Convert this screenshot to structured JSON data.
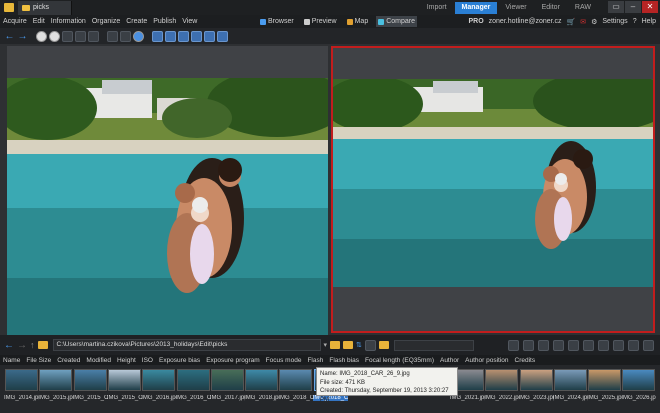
{
  "tab_title": "picks",
  "modes": [
    "Import",
    "Manager",
    "Viewer",
    "Editor",
    "RAW"
  ],
  "active_mode": "Manager",
  "menu": [
    "Acquire",
    "Edit",
    "Information",
    "Organize",
    "Create",
    "Publish",
    "View"
  ],
  "views": [
    {
      "label": "Browser",
      "icon": "browser-icon",
      "color": "#4a9cf0"
    },
    {
      "label": "Preview",
      "icon": "preview-icon",
      "color": "#cccccc"
    },
    {
      "label": "Map",
      "icon": "map-icon",
      "color": "#e0a030"
    },
    {
      "label": "Compare",
      "icon": "compare-icon",
      "color": "#4ac0e0"
    }
  ],
  "account": {
    "tier": "PRO",
    "email": "zoner.hotline@zoner.cz",
    "settings": "Settings",
    "help": "Help"
  },
  "path": "C:\\Users\\martina.czikova\\Pictures\\2013_holidays\\Edit\\picks",
  "columns": [
    "Name",
    "File Size",
    "Created",
    "Modified",
    "Height",
    "ISO",
    "Exposure bias",
    "Exposure program",
    "Focus mode",
    "Flash",
    "Flash bias",
    "Focal length (EQ35mm)",
    "Author",
    "Author position",
    "Credits"
  ],
  "thumbs": [
    {
      "label": "IMG_2014.jpg",
      "sel": false
    },
    {
      "label": "IMG_2015.jpg",
      "sel": false
    },
    {
      "label": "IMG_2015_C...",
      "sel": false
    },
    {
      "label": "IMG_2015_C...",
      "sel": false
    },
    {
      "label": "IMG_2016.jpg",
      "sel": false
    },
    {
      "label": "IMG_2016_C...",
      "sel": false
    },
    {
      "label": "IMG_2017.jpg",
      "sel": false
    },
    {
      "label": "IMG_2018.jpg",
      "sel": false
    },
    {
      "label": "IMG_2018_C...",
      "sel": false
    },
    {
      "label": "IMG_2018_C...",
      "sel": true
    },
    {
      "label": "",
      "sel": false
    },
    {
      "label": "",
      "sel": false
    },
    {
      "label": "",
      "sel": false
    },
    {
      "label": "IMG_2021.jpg",
      "sel": false
    },
    {
      "label": "IMG_2022.jpg",
      "sel": false
    },
    {
      "label": "IMG_2023.jpg",
      "sel": false
    },
    {
      "label": "IMG_2024.jpg",
      "sel": false
    },
    {
      "label": "IMG_2025.jpg",
      "sel": false
    },
    {
      "label": "IMG_2026.jpg",
      "sel": false
    }
  ],
  "tooltip": {
    "name": "Name: IMG_2018_CAR_26_9.jpg",
    "size": "File size: 471 KB",
    "created": "Created: Thursday, September 19, 2013 3:20:27 PM"
  }
}
